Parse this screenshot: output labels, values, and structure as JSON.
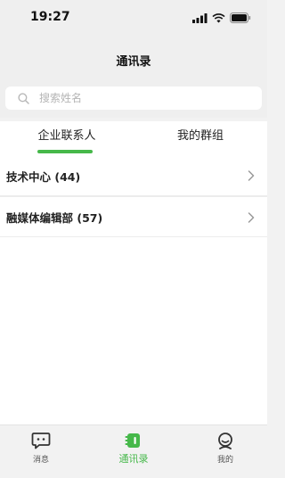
{
  "status_bar": {
    "time": "19:27",
    "icons": [
      "signal-icon",
      "wifi-icon",
      "battery-icon"
    ]
  },
  "nav": {
    "title": "通讯录"
  },
  "search": {
    "placeholder": "搜索姓名",
    "value": ""
  },
  "tabs": [
    {
      "label": "企业联系人",
      "active": true
    },
    {
      "label": "我的群组",
      "active": false
    }
  ],
  "departments": [
    {
      "label": "技术中心 (44)"
    },
    {
      "label": "融媒体编辑部 (57)"
    }
  ],
  "bottom_tabs": [
    {
      "label": "消息",
      "icon": "message-icon",
      "active": false
    },
    {
      "label": "通讯录",
      "icon": "contacts-icon",
      "active": true
    },
    {
      "label": "我的",
      "icon": "profile-icon",
      "active": false
    }
  ],
  "colors": {
    "accent": "#46b84a",
    "background": "#f2f2f2",
    "surface": "#ffffff"
  }
}
